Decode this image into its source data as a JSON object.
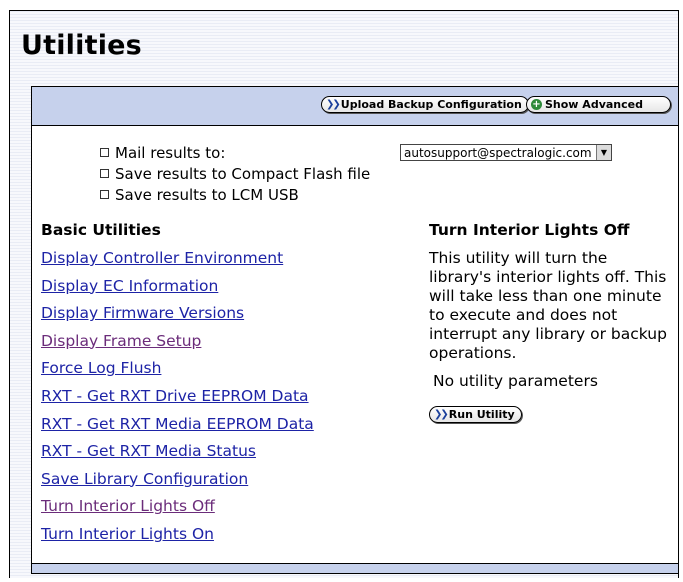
{
  "page": {
    "title": "Utilities"
  },
  "toolbar": {
    "upload_label": "Upload Backup Configuration",
    "advanced_label": "Show Advanced"
  },
  "options": {
    "mail_label": "Mail results to:",
    "compact_flash_label": "Save results to Compact Flash file",
    "lcm_usb_label": "Save results to LCM USB",
    "mail_selected": "autosupport@spectralogic.com"
  },
  "basic_utilities": {
    "heading": "Basic Utilities",
    "items": [
      {
        "label": "Display Controller Environment",
        "visited": false
      },
      {
        "label": "Display EC Information",
        "visited": false
      },
      {
        "label": "Display Firmware Versions",
        "visited": false
      },
      {
        "label": "Display Frame Setup",
        "visited": true
      },
      {
        "label": "Force Log Flush",
        "visited": false
      },
      {
        "label": "RXT - Get RXT Drive EEPROM Data",
        "visited": false
      },
      {
        "label": "RXT - Get RXT Media EEPROM Data",
        "visited": false
      },
      {
        "label": "RXT - Get RXT Media Status",
        "visited": false
      },
      {
        "label": "Save Library Configuration",
        "visited": false
      },
      {
        "label": "Turn Interior Lights Off",
        "visited": true
      },
      {
        "label": "Turn Interior Lights On",
        "visited": false
      }
    ]
  },
  "detail": {
    "heading": "Turn Interior Lights Off",
    "description": "This utility will turn the library's interior lights off. This will take less than one minute to execute and does not interrupt any library or backup operations.",
    "params": "No utility parameters",
    "run_label": "Run Utility"
  },
  "colors": {
    "toolbar_bg": "#c6d1ec",
    "link": "#1d23a6",
    "visited_link": "#6b2c7a"
  }
}
